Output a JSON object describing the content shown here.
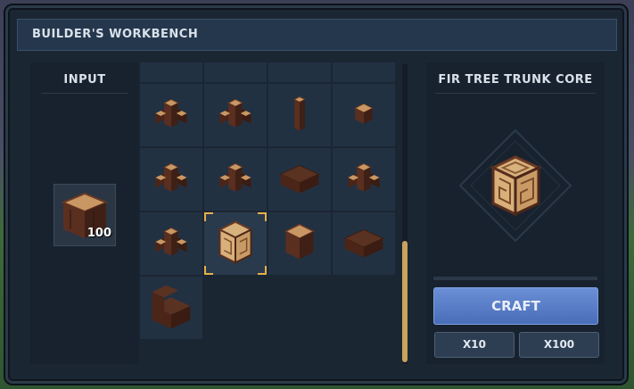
{
  "window": {
    "title": "BUILDER'S WORKBENCH"
  },
  "input": {
    "title": "INPUT",
    "item": {
      "icon": "wood-block-icon",
      "count": "100"
    }
  },
  "recipes": [
    {
      "icon": "wood-stairs-corner-icon"
    },
    {
      "icon": "wood-cross-icon"
    },
    {
      "icon": "wood-junction-icon"
    },
    {
      "icon": "wood-corner-icon"
    },
    {
      "icon": "wood-post-cross-icon"
    },
    {
      "icon": "wood-junction-5-icon"
    },
    {
      "icon": "wood-pillar-icon"
    },
    {
      "icon": "wood-small-cube-icon"
    },
    {
      "icon": "wood-t-junction-icon"
    },
    {
      "icon": "wood-t-low-icon"
    },
    {
      "icon": "wood-l-piece-icon"
    },
    {
      "icon": "wood-cross-tall-icon"
    },
    {
      "icon": "wood-cross-flat-icon"
    },
    {
      "icon": "fir-trunk-core-icon",
      "selected": true
    },
    {
      "icon": "wood-block-icon"
    },
    {
      "icon": "wood-slab-icon"
    },
    {
      "icon": "wood-stairs-icon"
    }
  ],
  "output": {
    "title": "FIR TREE TRUNK CORE",
    "icon": "fir-trunk-core-icon",
    "craft_label": "CRAFT",
    "x10_label": "X10",
    "x100_label": "X100"
  },
  "colors": {
    "accent": "#e6b049",
    "craft_button": "#5a7ec8",
    "panel": "#18222e",
    "wood_dark": "#4a2a1e",
    "wood_light": "#c99763"
  }
}
